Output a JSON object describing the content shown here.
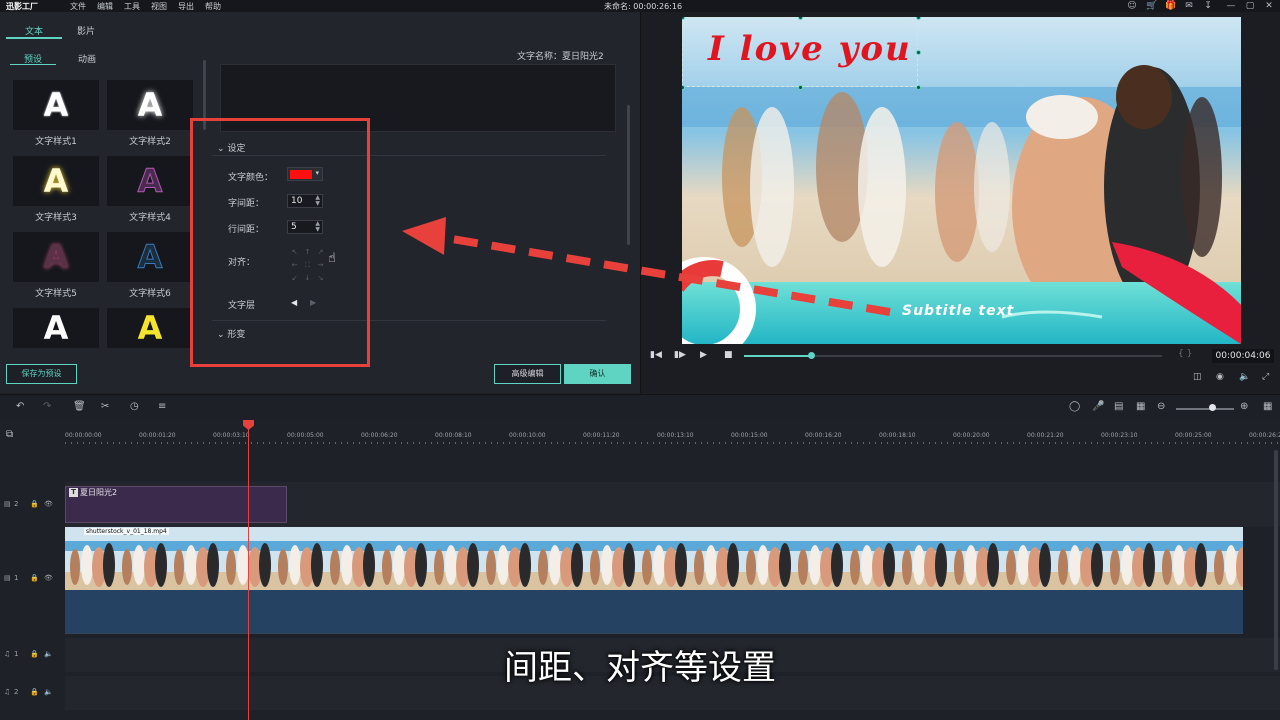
{
  "app": {
    "logo_text": "迅影工厂",
    "menu": [
      "文件",
      "编辑",
      "工具",
      "视图",
      "导出",
      "帮助"
    ],
    "project_title": "未命名: 00:00:26:16",
    "window_icons": [
      "user-icon",
      "cart-icon",
      "gift-icon",
      "mail-icon",
      "download-icon",
      "minimize-icon",
      "restore-icon",
      "close-icon"
    ]
  },
  "editor": {
    "tabs": [
      "文本",
      "影片"
    ],
    "subtabs": [
      "预设",
      "动画"
    ],
    "presets": [
      {
        "glyph": "A",
        "label": "文字样式1"
      },
      {
        "glyph": "A",
        "label": "文字样式2"
      },
      {
        "glyph": "A",
        "label": "文字样式3"
      },
      {
        "glyph": "A",
        "label": "文字样式4"
      },
      {
        "glyph": "A",
        "label": "文字样式5"
      },
      {
        "glyph": "A",
        "label": "文字样式6"
      },
      {
        "glyph": "A",
        "label": ""
      },
      {
        "glyph": "A",
        "label": ""
      }
    ],
    "text_name": "文字名称：夏日阳光2",
    "settings_header": "设定",
    "text_color_label": "文字颜色：",
    "text_color": "#ff1010",
    "letter_spacing_label": "字间距：",
    "letter_spacing_value": "10",
    "line_spacing_label": "行间距：",
    "line_spacing_value": "5",
    "align_label": "对齐：",
    "align_icons": [
      "↖",
      "↑",
      "↗",
      "←",
      "⛶",
      "→",
      "↙",
      "↓",
      "↘"
    ],
    "layer_label": "文字层",
    "transform_header": "形变",
    "buttons": {
      "save_preset": "保存为预设",
      "advanced_edit": "高级编辑",
      "confirm": "确认"
    }
  },
  "preview": {
    "overlay_title": "I love you",
    "subtitle": "Subtitle text",
    "timecode": "00:00:04:06",
    "playback_progress": 0.16,
    "braces": "{ }"
  },
  "timeline": {
    "ruler_labels": [
      "00:00:00:00",
      "00:00:01:20",
      "00:00:03:10",
      "00:00:05:00",
      "00:00:06:20",
      "00:00:08:10",
      "00:00:10:00",
      "00:00:11:20",
      "00:00:13:10",
      "00:00:15:00",
      "00:00:16:20",
      "00:00:18:10",
      "00:00:20:00",
      "00:00:21:20",
      "00:00:23:10",
      "00:00:25:00",
      "00:00:26:20"
    ],
    "tracks": {
      "t2": "2",
      "v1": "1",
      "a1": "1",
      "a2": "2"
    },
    "text_clip_label": "夏日阳光2",
    "video_clip_label": "shutterstock_v_01_18.mp4",
    "zoom_level": 0.62
  },
  "caption": "间距、对齐等设置",
  "colors": {
    "accent": "#5fd4c2",
    "highlight_red": "#e8403b",
    "text_clip": "#3c2a4d",
    "audio_clip": "#254262"
  }
}
